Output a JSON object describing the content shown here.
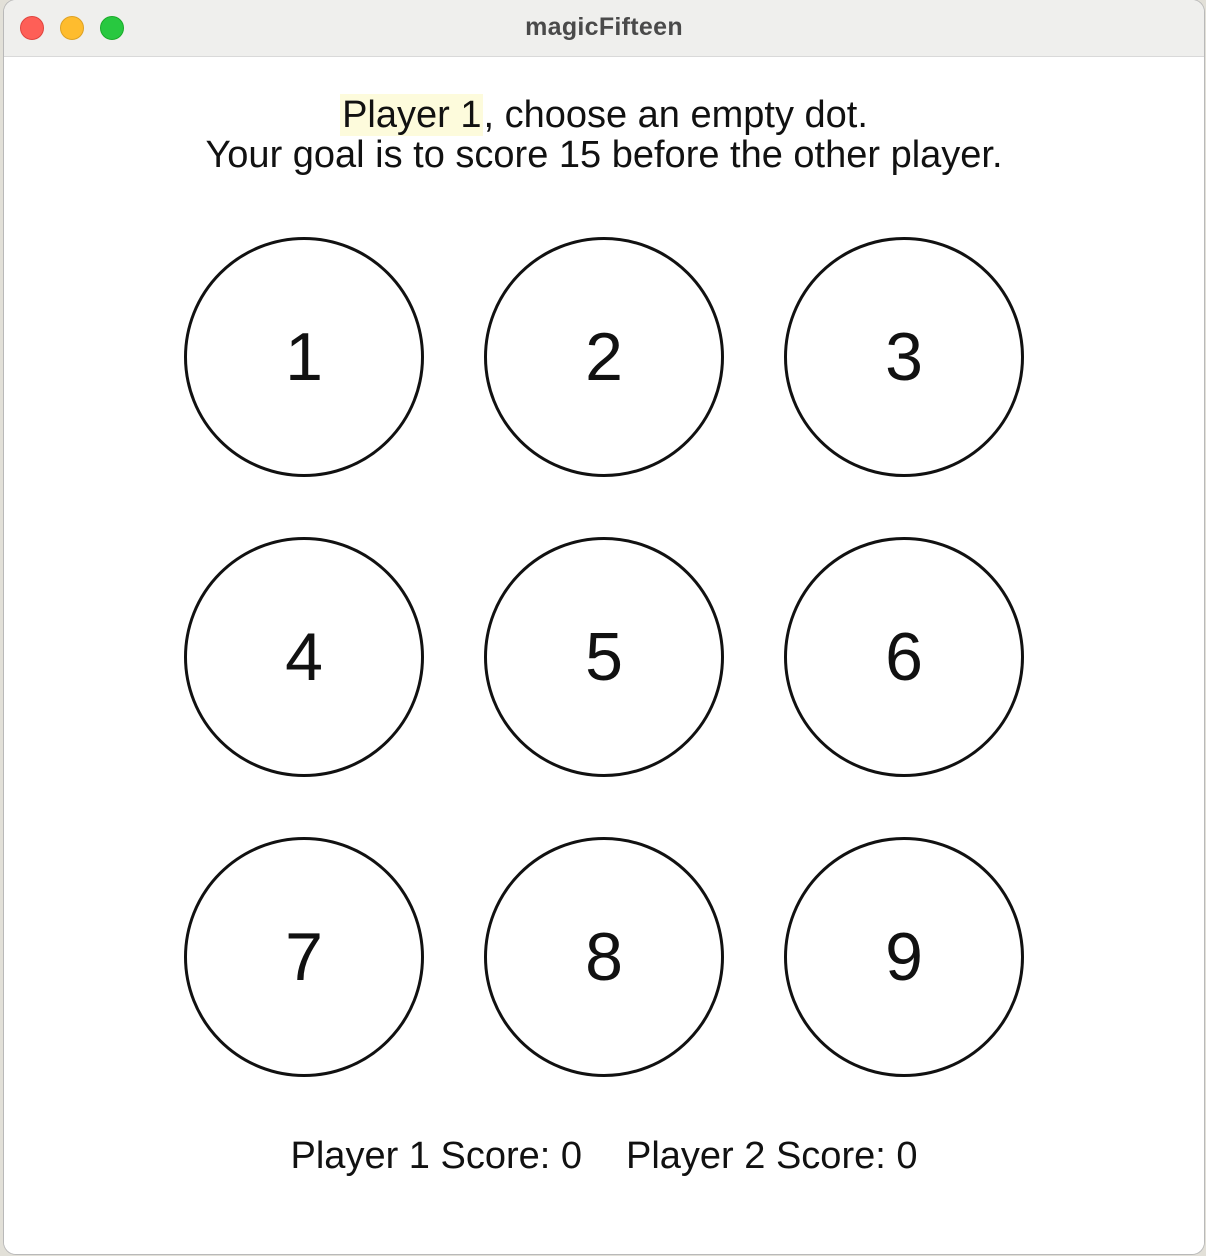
{
  "window": {
    "title": "magicFifteen"
  },
  "instructions": {
    "current_player": "Player 1",
    "line1_rest": ", choose an empty dot.",
    "line2": "Your goal is to score 15 before the other player."
  },
  "dots": [
    {
      "label": "1"
    },
    {
      "label": "2"
    },
    {
      "label": "3"
    },
    {
      "label": "4"
    },
    {
      "label": "5"
    },
    {
      "label": "6"
    },
    {
      "label": "7"
    },
    {
      "label": "8"
    },
    {
      "label": "9"
    }
  ],
  "scores": {
    "player1": "Player 1 Score: 0",
    "player2": "Player 2 Score: 0"
  },
  "colors": {
    "highlight": "#fdfbdc",
    "close": "#fe5f57",
    "minimize": "#febc2e",
    "zoom": "#28c840"
  }
}
